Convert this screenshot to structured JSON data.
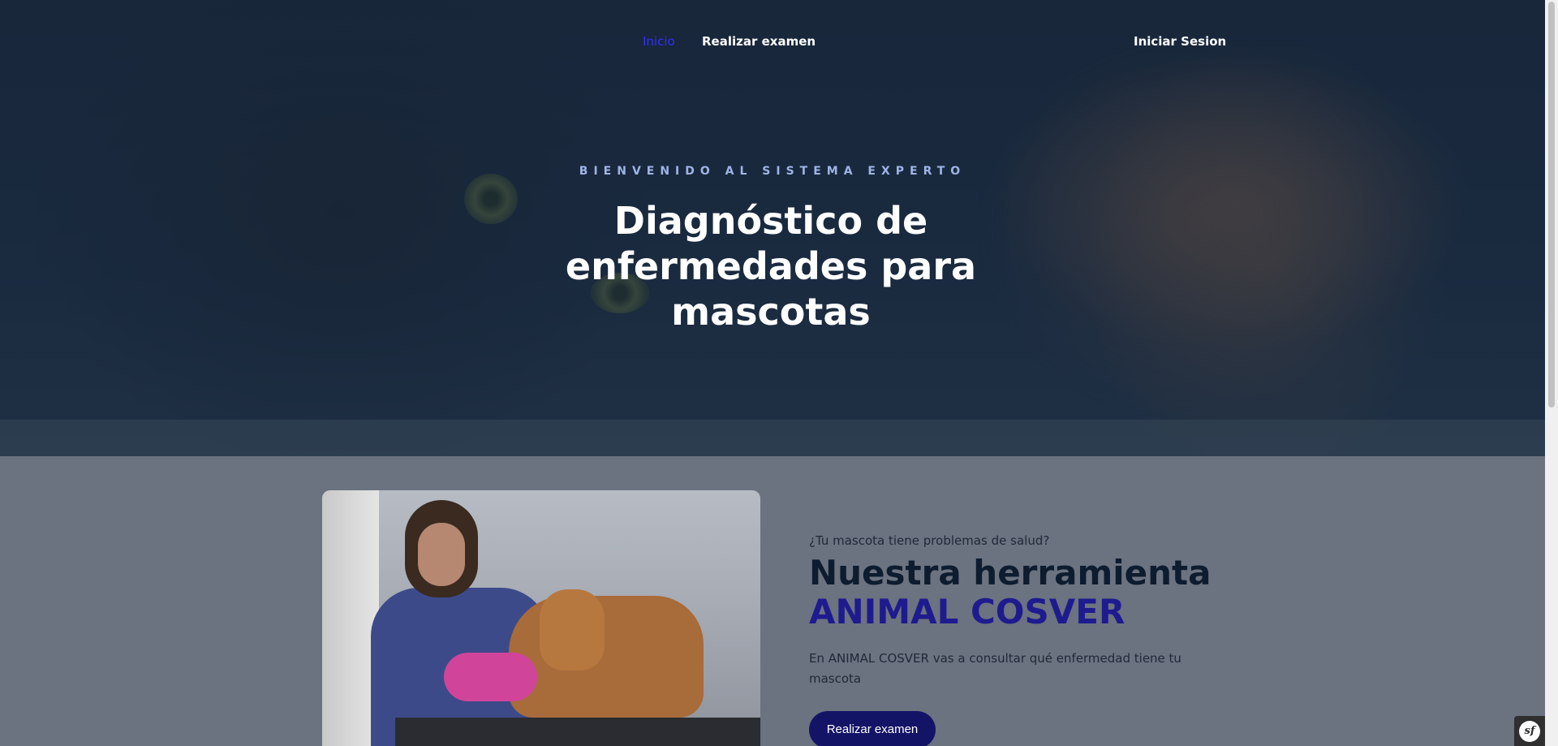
{
  "nav": {
    "home_label": "Inicio",
    "exam_label": "Realizar examen",
    "login_label": "Iniciar Sesion"
  },
  "hero": {
    "kicker": "BIENVENIDO AL SISTEMA EXPERTO",
    "title": "Diagnóstico de enfermedades para mascotas"
  },
  "feature": {
    "question": "¿Tu mascota tiene problemas de salud?",
    "heading": "Nuestra herramienta",
    "brand": "ANIMAL COSVER",
    "description": "En ANIMAL COSVER vas a consultar qué enfermedad tiene tu mascota",
    "cta_label": "Realizar examen"
  },
  "badge": {
    "label": "sf"
  },
  "colors": {
    "active_nav": "#2f2fff",
    "brand": "#1e1b8f",
    "cta_bg": "#141467",
    "kicker": "#9fb4e6"
  }
}
